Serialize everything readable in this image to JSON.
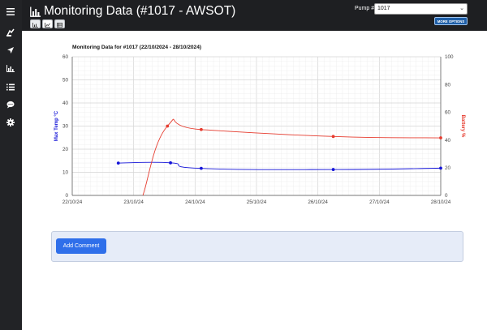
{
  "header": {
    "title": "Monitoring Data (#1017 - AWSOT)",
    "pump_label": "Pump #:",
    "pump_selected": "1017",
    "more_options_label": "MORE OPTIONS",
    "view_tabs": [
      {
        "name": "table-view-tab",
        "icon": "table-icon"
      },
      {
        "name": "line-chart-view-tab",
        "icon": "line-chart-icon"
      },
      {
        "name": "grid-view-tab",
        "icon": "grid-icon"
      }
    ]
  },
  "sidebar": {
    "icons": [
      "menu-icon",
      "fuel-pump-icon",
      "send-icon",
      "bar-chart-icon",
      "list-icon",
      "chat-icon",
      "gear-icon"
    ]
  },
  "comment": {
    "button_label": "Add Comment"
  },
  "chart_data": {
    "type": "line",
    "title": "Monitoring Data for #1017 (22/10/2024 - 28/10/2024)",
    "x_ticks": [
      "22/10/24",
      "23/10/24",
      "24/10/24",
      "25/10/24",
      "26/10/24",
      "27/10/24",
      "28/10/24"
    ],
    "ylabel_left": "Max Temp °C",
    "ylabel_right": "Battery %",
    "ylim_left": [
      0,
      60
    ],
    "ylim_right": [
      0,
      100
    ],
    "y_ticks_left": [
      0,
      10,
      20,
      30,
      40,
      50,
      60
    ],
    "y_ticks_right": [
      0,
      20,
      40,
      60,
      80,
      100
    ],
    "grid": true,
    "series": [
      {
        "name": "Max Temp °C",
        "axis": "left",
        "color": "#1414d8",
        "x": [
          0.75,
          1.6,
          2.1,
          4.25,
          6.0
        ],
        "values": [
          14,
          14.1,
          11.7,
          11.2,
          11.8
        ]
      },
      {
        "name": "Battery %",
        "axis": "right",
        "color": "#e63b2e",
        "x": [
          1.55,
          2.1,
          4.25,
          6.0
        ],
        "values": [
          50,
          47.5,
          42.5,
          41.5
        ],
        "line_start": {
          "x": 1.15,
          "value": 0
        }
      }
    ]
  }
}
